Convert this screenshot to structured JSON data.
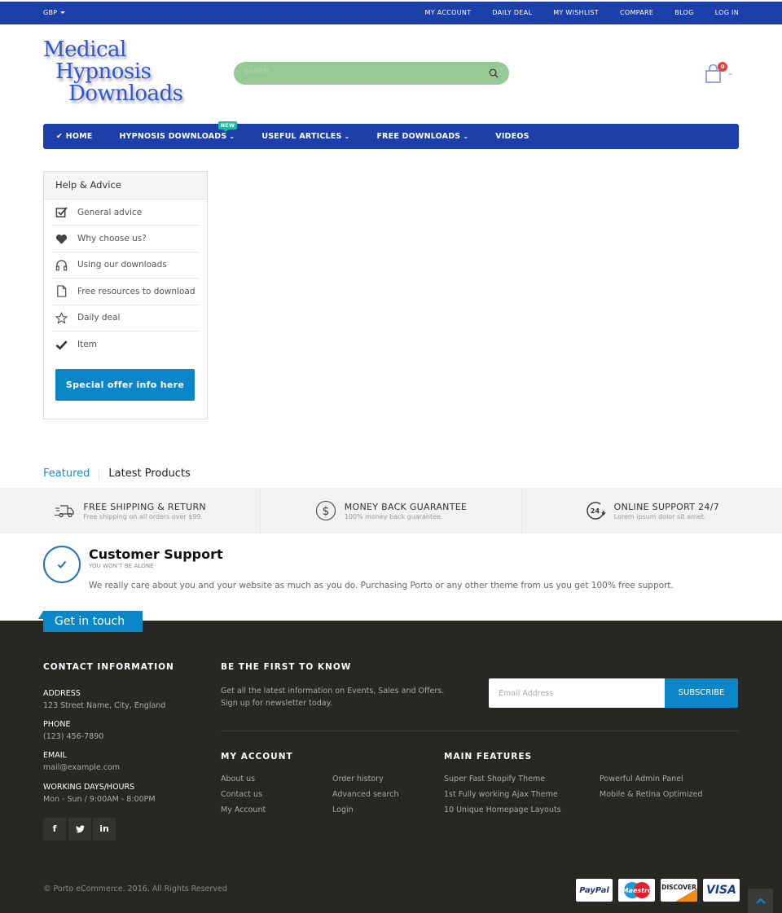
{
  "topbar": {
    "currency": "GBP",
    "links": [
      "MY ACCOUNT",
      "DAILY DEAL",
      "MY WISHLIST",
      "COMPARE",
      "BLOG",
      "LOG IN"
    ]
  },
  "header": {
    "logo_lines": [
      "Medical",
      "Hypnosis",
      "Downloads"
    ],
    "search_placeholder": "Search",
    "cart_count": "0"
  },
  "nav": {
    "items": [
      {
        "label": "HOME",
        "icon": "check"
      },
      {
        "label": "HYPNOSIS DOWNLOADS",
        "badge": "NEW",
        "dropdown": true
      },
      {
        "label": "USEFUL ARTICLES",
        "dropdown": true
      },
      {
        "label": "FREE DOWNLOADS",
        "dropdown": true
      },
      {
        "label": "VIDEOS"
      }
    ]
  },
  "sidebar": {
    "title": "Help & Advice",
    "items": [
      {
        "label": "General advice",
        "icon": "check-square-icon"
      },
      {
        "label": "Why choose us?",
        "icon": "heart-icon"
      },
      {
        "label": "Using our downloads",
        "icon": "headphones-icon"
      },
      {
        "label": "Free resources to download",
        "icon": "file-icon"
      },
      {
        "label": "Daily deal",
        "icon": "star-icon"
      },
      {
        "label": "Item",
        "icon": "check-icon"
      }
    ],
    "button": "Special offer info here"
  },
  "tabs": [
    "Featured",
    "Latest Products"
  ],
  "features": [
    {
      "title": "FREE SHIPPING & RETURN",
      "sub": "Free shipping on all orders over $99.",
      "icon": "truck-icon"
    },
    {
      "title": "MONEY BACK GUARANTEE",
      "sub": "100% money back guarantee.",
      "icon": "dollar-icon"
    },
    {
      "title": "ONLINE SUPPORT 24/7",
      "sub": "Lorem ipsum dolor sit amet.",
      "icon": "support-24-icon"
    }
  ],
  "support": {
    "title": "Customer Support",
    "subtitle": "YOU WON'T BE ALONE",
    "text": "We really care about you and your website as much as you do. Purchasing Porto or any other theme from us you get 100% free support."
  },
  "footer": {
    "get_in_touch": "Get in touch",
    "contact": {
      "heading": "CONTACT INFORMATION",
      "address_label": "ADDRESS",
      "address": "123 Street Name, City, England",
      "phone_label": "PHONE",
      "phone": "(123) 456-7890",
      "email_label": "EMAIL",
      "email": "mail@example.com",
      "hours_label": "WORKING DAYS/HOURS",
      "hours": "Mon - Sun / 9:00AM - 8:00PM"
    },
    "social": [
      "f",
      "t",
      "in"
    ],
    "newsletter": {
      "heading": "BE THE FIRST TO KNOW",
      "text1": "Get all the latest information on Events, Sales and Offers.",
      "text2": "Sign up for newsletter today.",
      "placeholder": "Email Address",
      "button": "SUBSCRIBE"
    },
    "account": {
      "heading": "MY ACCOUNT",
      "col1": [
        "About us",
        "Contact us",
        "My Account"
      ],
      "col2": [
        "Order history",
        "Advanced search",
        "Login"
      ]
    },
    "features": {
      "heading": "MAIN FEATURES",
      "col1": [
        "Super Fast Shopify Theme",
        "1st Fully working Ajax Theme",
        "10 Unique Homepage Layouts"
      ],
      "col2": [
        "Powerful Admin Panel",
        "Mobile & Retina Optimized"
      ]
    },
    "copyright": "© Porto eCommerce. 2016. All Rights Reserved",
    "payments": [
      "PayPal",
      "Maestro",
      "DISCOVER",
      "VISA"
    ]
  }
}
